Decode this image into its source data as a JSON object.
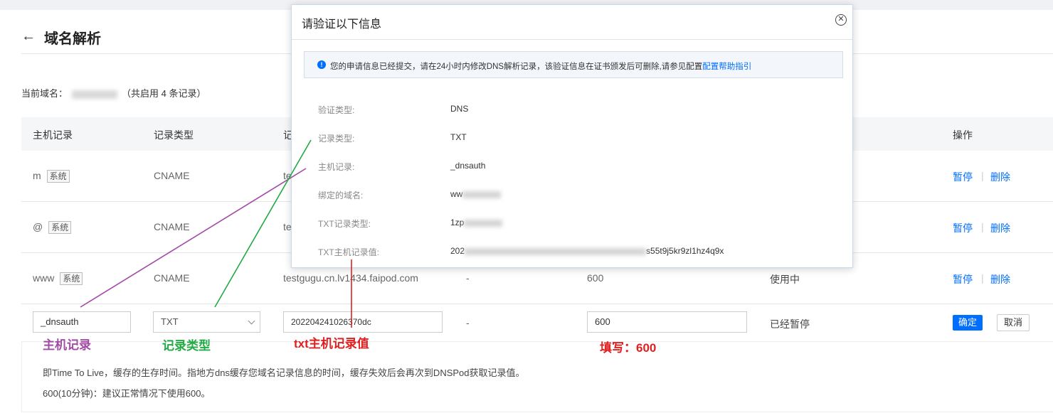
{
  "header": {
    "back_icon": "←",
    "title": "域名解析"
  },
  "domain_info": {
    "label": "当前域名：",
    "suffix": "（共启用 4 条记录）"
  },
  "table": {
    "columns": [
      "主机记录",
      "记录类型",
      "记",
      "操作"
    ],
    "rows": [
      {
        "host": "m",
        "tag": "系统",
        "type": "CNAME",
        "value": "te",
        "pause": "暂停",
        "delete": "删除"
      },
      {
        "host": "@",
        "tag": "系统",
        "type": "CNAME",
        "value": "te",
        "pause": "暂停",
        "delete": "删除"
      },
      {
        "host": "www",
        "tag": "系统",
        "type": "CNAME",
        "value": "testgugu.cn.lv1434.faipod.com",
        "line": "-",
        "ttl": "600",
        "status": "使用中",
        "pause": "暂停",
        "delete": "删除"
      }
    ],
    "edit_row": {
      "host_value": "_dnsauth",
      "type_value": "TXT",
      "record_value": "202204241026370dc",
      "line": "-",
      "ttl_value": "600",
      "status": "已经暂停",
      "confirm": "确定",
      "cancel": "取消"
    }
  },
  "ttl_info": {
    "line1": "即Time To Live，缓存的生存时间。指地方dns缓存您域名记录信息的时间，缓存失效后会再次到DNSPod获取记录值。",
    "line2": "600(10分钟)：建议正常情况下使用600。"
  },
  "annotations": {
    "host": "主机记录",
    "type": "记录类型",
    "txt": "txt主机记录值",
    "ttl": "填写：600",
    "colors": {
      "host": "#a24aa6",
      "type": "#22aa44",
      "txt": "#e02020",
      "ttl": "#e02020"
    }
  },
  "modal": {
    "title": "请验证以下信息",
    "close_icon": "close-circle-icon",
    "notice": "您的申请信息已经提交，请在24小时内修改DNS解析记录，该验证信息在证书颁发后可删除,请参见配置",
    "notice_link": "配置帮助指引",
    "fields": [
      {
        "label": "验证类型:",
        "value": "DNS"
      },
      {
        "label": "记录类型:",
        "value": "TXT"
      },
      {
        "label": "主机记录:",
        "value": "_dnsauth"
      },
      {
        "label": "绑定的域名:",
        "value": "ww"
      },
      {
        "label": "TXT记录类型:",
        "value": "1zp"
      },
      {
        "label": "TXT主机记录值:",
        "value_prefix": "202",
        "value": "s55t9j5kr9zl1hz4q9x"
      }
    ]
  },
  "accent_color": "#006eff"
}
